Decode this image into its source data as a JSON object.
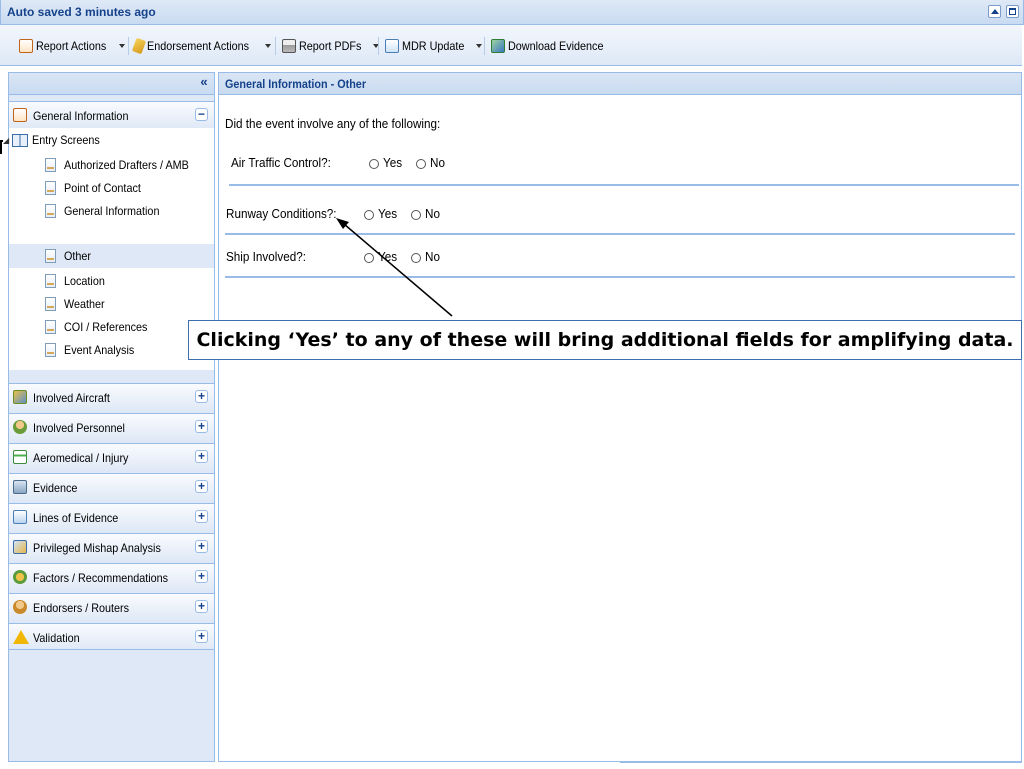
{
  "titlebar": {
    "title": "Auto saved 3 minutes ago"
  },
  "toolbar": {
    "report_actions": "Report Actions",
    "endorsement_actions": "Endorsement Actions",
    "report_pdfs": "Report PDFs",
    "mdr_update": "MDR Update",
    "download_evidence": "Download Evidence"
  },
  "sidebar": {
    "general_information": "General Information",
    "entry_screens": "Entry Screens",
    "items": [
      "Authorized Drafters / AMB",
      "Point of Contact",
      "General Information",
      "Other",
      "Location",
      "Weather",
      "COI / References",
      "Event Analysis"
    ],
    "selected_item": "Other",
    "sections": [
      {
        "label": "Involved Aircraft",
        "icon": "aircraft-icon"
      },
      {
        "label": "Involved Personnel",
        "icon": "personnel-icon"
      },
      {
        "label": "Aeromedical / Injury",
        "icon": "aeromedical-icon"
      },
      {
        "label": "Evidence",
        "icon": "evidence-icon"
      },
      {
        "label": "Lines of Evidence",
        "icon": "lines-of-evidence-icon"
      },
      {
        "label": "Privileged Mishap Analysis",
        "icon": "analysis-icon"
      },
      {
        "label": "Factors / Recommendations",
        "icon": "factors-icon"
      },
      {
        "label": "Endorsers / Routers",
        "icon": "endorsers-icon"
      },
      {
        "label": "Validation",
        "icon": "warning-icon"
      }
    ]
  },
  "main": {
    "header": "General Information - Other",
    "prompt": "Did the event involve any of the following:",
    "yes_label": "Yes",
    "no_label": "No",
    "questions": [
      {
        "label": "Air Traffic Control?:"
      },
      {
        "label": "Runway Conditions?:"
      },
      {
        "label": "Ship Involved?:"
      }
    ]
  },
  "callout": {
    "text": "Clicking ‘Yes’ to any of these will bring additional fields for amplifying data."
  },
  "colors": {
    "header_text": "#15428b",
    "panel_border": "#99bbe8",
    "panel_bg": "#dfe8f6"
  }
}
